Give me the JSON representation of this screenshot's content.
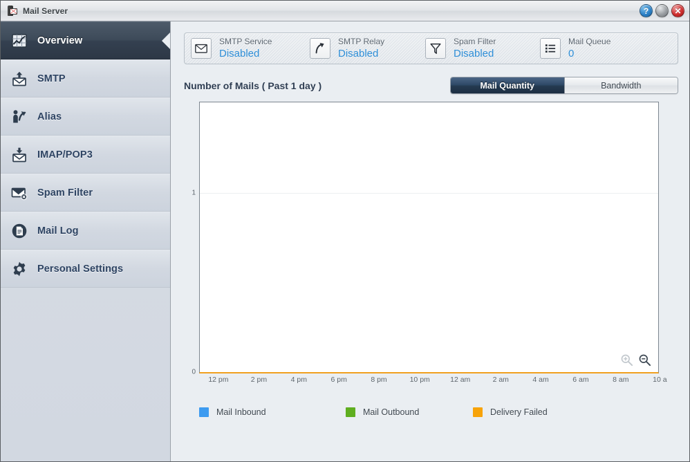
{
  "window": {
    "title": "Mail Server",
    "icon": "mail-server-icon",
    "buttons": [
      {
        "name": "help-button",
        "glyph": "?"
      },
      {
        "name": "minimize-button",
        "glyph": ""
      },
      {
        "name": "close-button",
        "glyph": "✕"
      }
    ]
  },
  "sidebar": {
    "items": [
      {
        "key": "overview",
        "label": "Overview",
        "icon": "chart-grid-icon",
        "active": true
      },
      {
        "key": "smtp",
        "label": "SMTP",
        "icon": "envelope-up-icon",
        "active": false
      },
      {
        "key": "alias",
        "label": "Alias",
        "icon": "person-arrow-icon",
        "active": false
      },
      {
        "key": "imap-pop3",
        "label": "IMAP/POP3",
        "icon": "envelope-down-icon",
        "active": false
      },
      {
        "key": "spam-filter",
        "label": "Spam Filter",
        "icon": "envelope-block-icon",
        "active": false
      },
      {
        "key": "mail-log",
        "label": "Mail Log",
        "icon": "document-circle-icon",
        "active": false
      },
      {
        "key": "personal-settings",
        "label": "Personal Settings",
        "icon": "gear-icon",
        "active": false
      }
    ]
  },
  "status_strip": {
    "items": [
      {
        "key": "smtp-service",
        "name": "SMTP Service",
        "value": "Disabled",
        "icon": "envelope-icon"
      },
      {
        "key": "smtp-relay",
        "name": "SMTP Relay",
        "value": "Disabled",
        "icon": "relay-arrow-icon"
      },
      {
        "key": "spam-filter",
        "name": "Spam Filter",
        "value": "Disabled",
        "icon": "funnel-icon"
      },
      {
        "key": "mail-queue",
        "name": "Mail Queue",
        "value": "0",
        "icon": "list-icon"
      }
    ],
    "value_color": "#2f8fd8"
  },
  "chart_panel": {
    "title": "Number of Mails ( Past 1 day )",
    "tabs": [
      {
        "key": "mail-quantity",
        "label": "Mail Quantity",
        "selected": true
      },
      {
        "key": "bandwidth",
        "label": "Bandwidth",
        "selected": false
      }
    ],
    "zoom_in_label": "zoom-in",
    "zoom_out_label": "zoom-out"
  },
  "chart_data": {
    "type": "line",
    "title": "Number of Mails ( Past 1 day )",
    "xlabel": "",
    "ylabel": "",
    "ylim": [
      0,
      1.35
    ],
    "yticks": [
      0,
      1
    ],
    "ytick_labels": [
      "0",
      "1"
    ],
    "grid": true,
    "grid_axis": "y",
    "legend_position": "bottom",
    "x": [
      "12 pm",
      "2 pm",
      "4 pm",
      "6 pm",
      "8 pm",
      "10 pm",
      "12 am",
      "2 am",
      "4 am",
      "6 am",
      "8 am",
      "10 a"
    ],
    "xtick_labels": [
      "12 pm",
      "2 pm",
      "4 pm",
      "6 pm",
      "8 pm",
      "10 pm",
      "12 am",
      "2 am",
      "4 am",
      "6 am",
      "8 am",
      "10 a"
    ],
    "series": [
      {
        "name": "Mail Inbound",
        "color": "#3d9bf0",
        "values": [
          0,
          0,
          0,
          0,
          0,
          0,
          0,
          0,
          0,
          0,
          0,
          0
        ]
      },
      {
        "name": "Mail Outbound",
        "color": "#5fae20",
        "values": [
          0,
          0,
          0,
          0,
          0,
          0,
          0,
          0,
          0,
          0,
          0,
          0
        ]
      },
      {
        "name": "Delivery Failed",
        "color": "#f7a30a",
        "values": [
          0,
          0,
          0,
          0,
          0,
          0,
          0,
          0,
          0,
          0,
          0,
          0
        ]
      }
    ],
    "note": "All series are flat at zero; only the orange baseline at y=0 is visible."
  }
}
